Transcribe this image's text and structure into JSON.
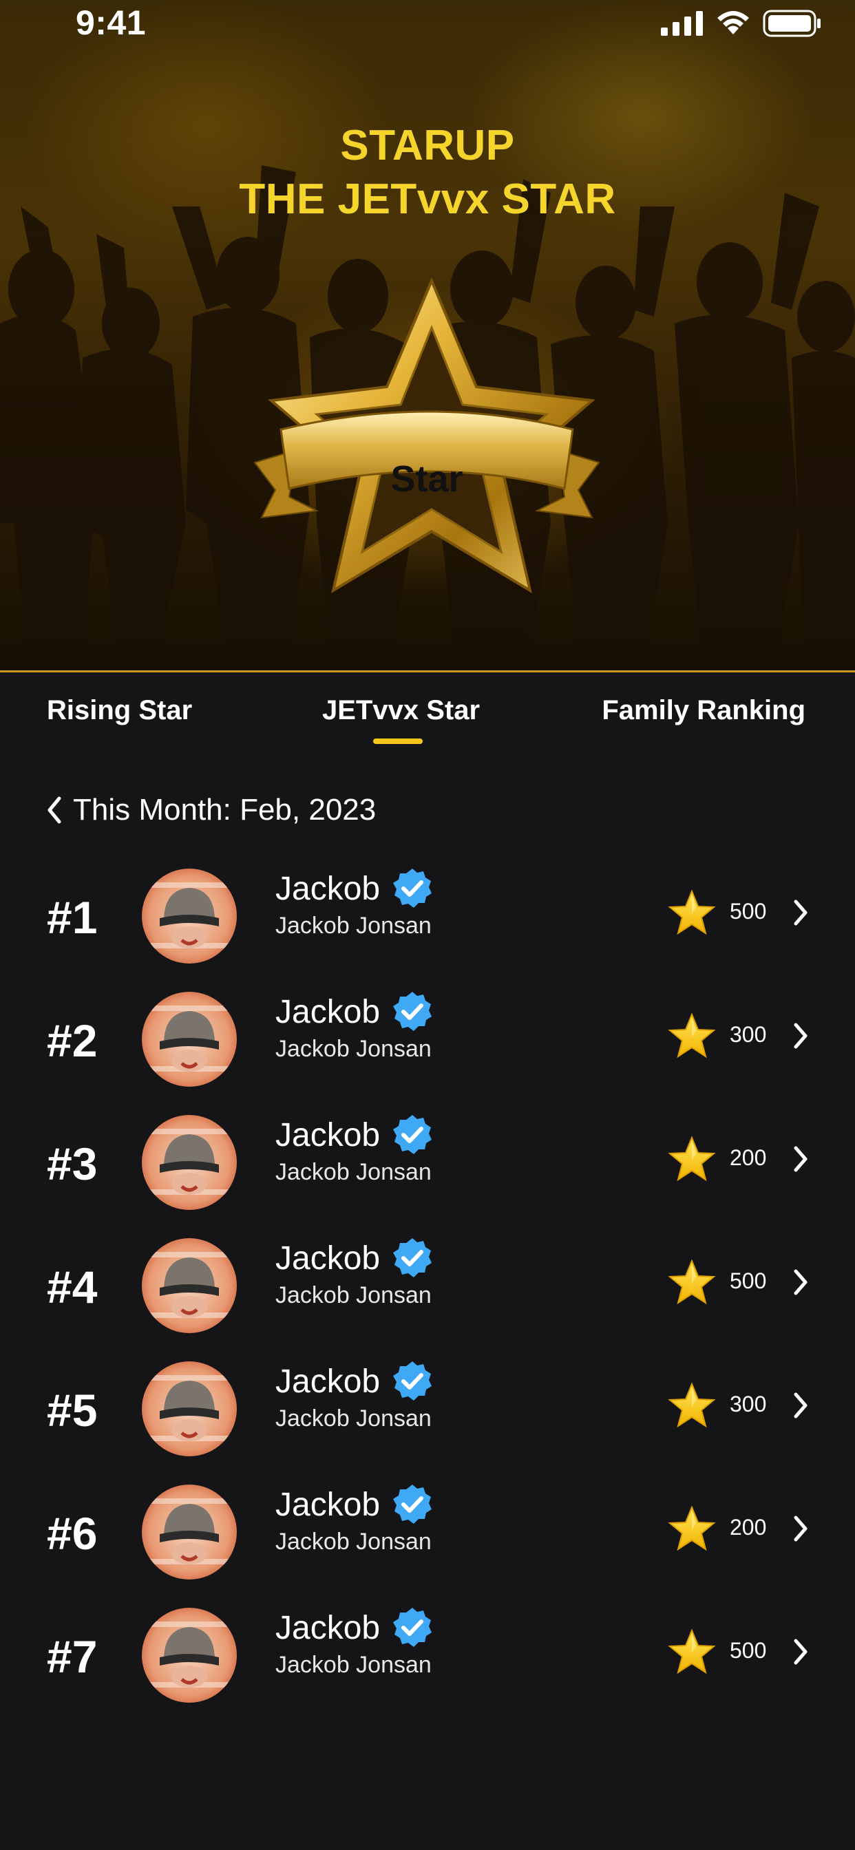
{
  "status_bar": {
    "time": "9:41"
  },
  "hero": {
    "title_line1": "STARUP",
    "title_line2": "THE JETvvx STAR",
    "badge_label": "Star"
  },
  "tabs": [
    {
      "label": "Rising Star",
      "active": false
    },
    {
      "label": "JETvvx Star",
      "active": true
    },
    {
      "label": "Family Ranking",
      "active": false
    }
  ],
  "month": {
    "label": "This Month: Feb, 2023"
  },
  "colors": {
    "accent": "#F5C518",
    "title": "#F5D52C",
    "verified": "#3FA9F5",
    "background": "#151517"
  },
  "leaderboard": [
    {
      "rank": "#1",
      "name": "Jackob",
      "full_name": "Jackob Jonsan",
      "score": "500",
      "verified": true
    },
    {
      "rank": "#2",
      "name": "Jackob",
      "full_name": "Jackob Jonsan",
      "score": "300",
      "verified": true
    },
    {
      "rank": "#3",
      "name": "Jackob",
      "full_name": "Jackob Jonsan",
      "score": "200",
      "verified": true
    },
    {
      "rank": "#4",
      "name": "Jackob",
      "full_name": "Jackob Jonsan",
      "score": "500",
      "verified": true
    },
    {
      "rank": "#5",
      "name": "Jackob",
      "full_name": "Jackob Jonsan",
      "score": "300",
      "verified": true
    },
    {
      "rank": "#6",
      "name": "Jackob",
      "full_name": "Jackob Jonsan",
      "score": "200",
      "verified": true
    },
    {
      "rank": "#7",
      "name": "Jackob",
      "full_name": "Jackob Jonsan",
      "score": "500",
      "verified": true
    }
  ]
}
